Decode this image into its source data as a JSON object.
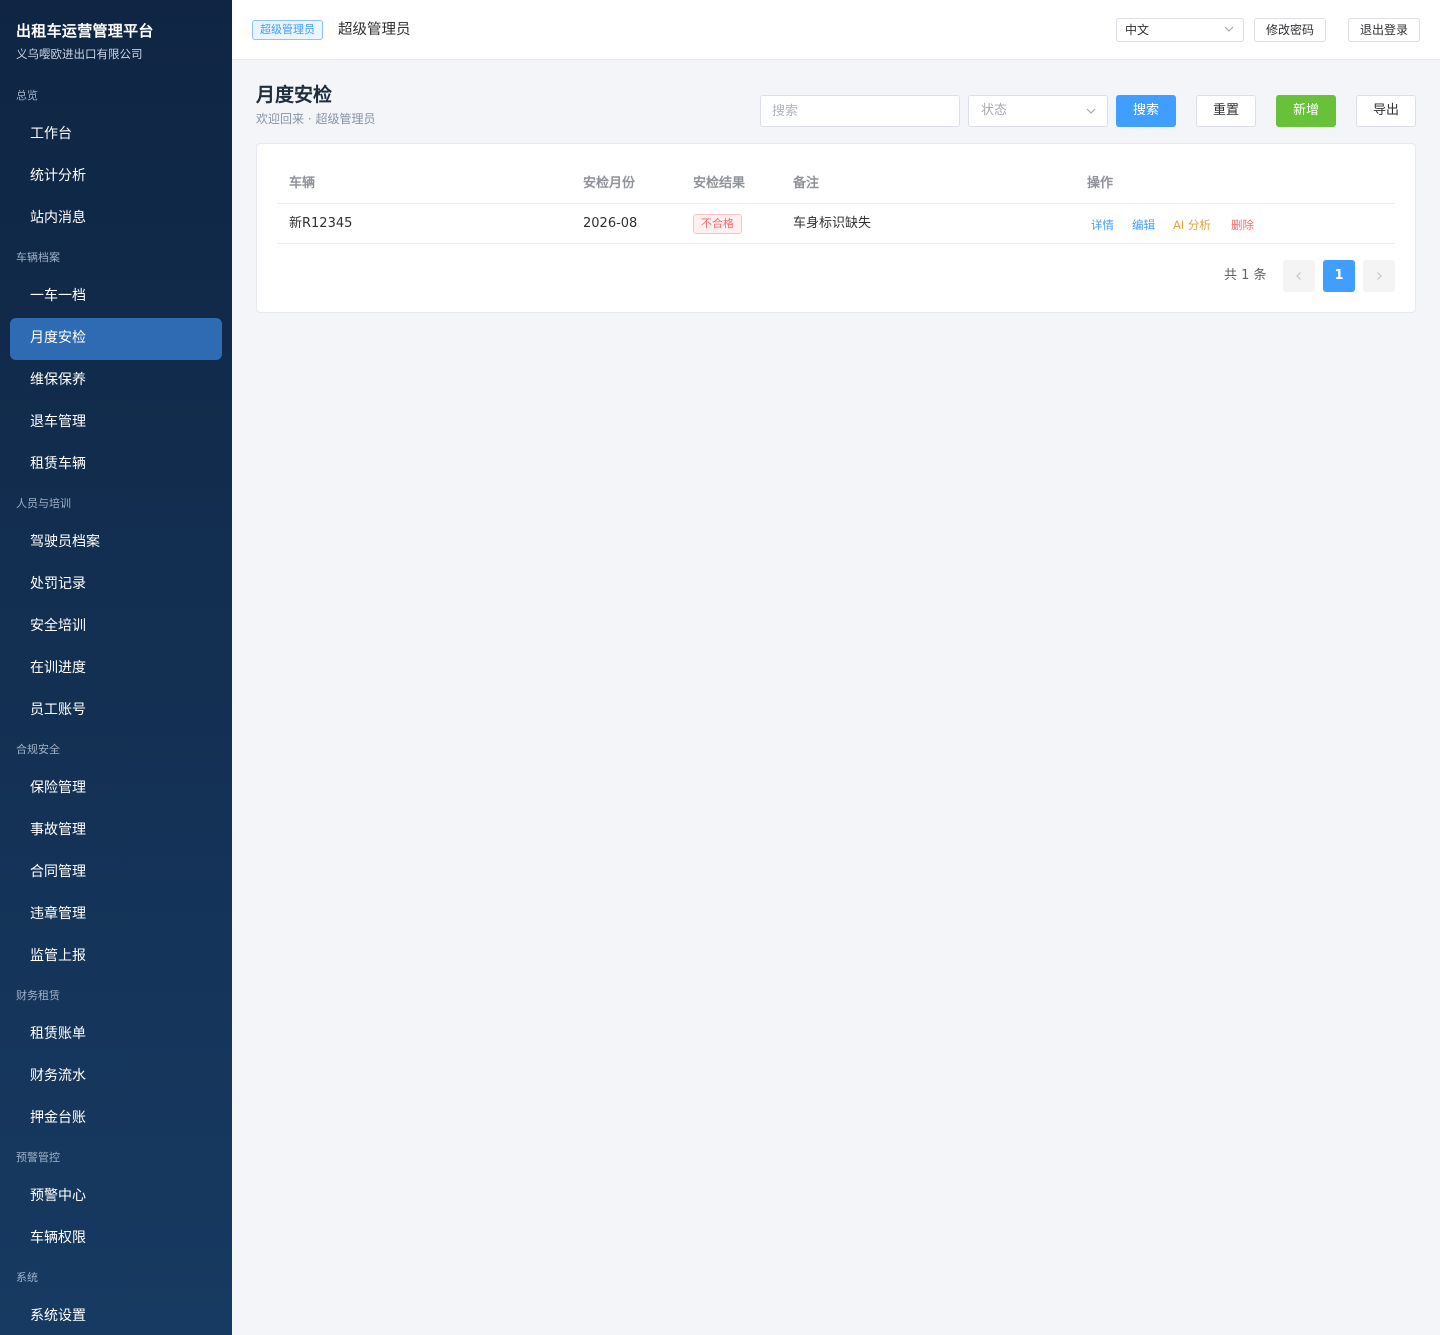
{
  "brand": {
    "title": "出租车运营管理平台",
    "subtitle": "义乌嘤欧进出口有限公司"
  },
  "sidebar": {
    "groups": [
      {
        "title": "总览",
        "items": [
          "工作台",
          "统计分析",
          "站内消息"
        ]
      },
      {
        "title": "车辆档案",
        "items": [
          "一车一档",
          "月度安检",
          "维保保养",
          "退车管理",
          "租赁车辆"
        ]
      },
      {
        "title": "人员与培训",
        "items": [
          "驾驶员档案",
          "处罚记录",
          "安全培训",
          "在训进度",
          "员工账号"
        ]
      },
      {
        "title": "合规安全",
        "items": [
          "保险管理",
          "事故管理",
          "合同管理",
          "违章管理",
          "监管上报"
        ]
      },
      {
        "title": "财务租赁",
        "items": [
          "租赁账单",
          "财务流水",
          "押金台账"
        ]
      },
      {
        "title": "预警管控",
        "items": [
          "预警中心",
          "车辆权限"
        ]
      },
      {
        "title": "系统",
        "items": [
          "系统设置"
        ]
      }
    ],
    "active": "月度安检"
  },
  "header": {
    "role_badge": "超级管理员",
    "role_name": "超级管理员",
    "language": "中文",
    "change_password": "修改密码",
    "logout": "退出登录"
  },
  "page": {
    "title": "月度安检",
    "subtitle": "欢迎回来 · 超级管理员"
  },
  "filters": {
    "search_placeholder": "搜索",
    "status_placeholder": "状态",
    "search_btn": "搜索",
    "reset_btn": "重置",
    "add_btn": "新增",
    "export_btn": "导出"
  },
  "table": {
    "columns": [
      "车辆",
      "安检月份",
      "安检结果",
      "备注",
      "操作"
    ],
    "rows": [
      {
        "vehicle": "新R12345",
        "month": "2026-08",
        "result": "不合格",
        "remark": "车身标识缺失"
      }
    ],
    "actions": {
      "detail": "详情",
      "edit": "编辑",
      "ai": "AI 分析",
      "delete": "删除"
    }
  },
  "pagination": {
    "total": "共 1 条",
    "current": "1"
  },
  "colors": {
    "primary": "#409eff",
    "success": "#67c23a",
    "danger": "#f56c6c",
    "warning": "#e6a23c",
    "sidebar_active": "#2f6bb3"
  }
}
